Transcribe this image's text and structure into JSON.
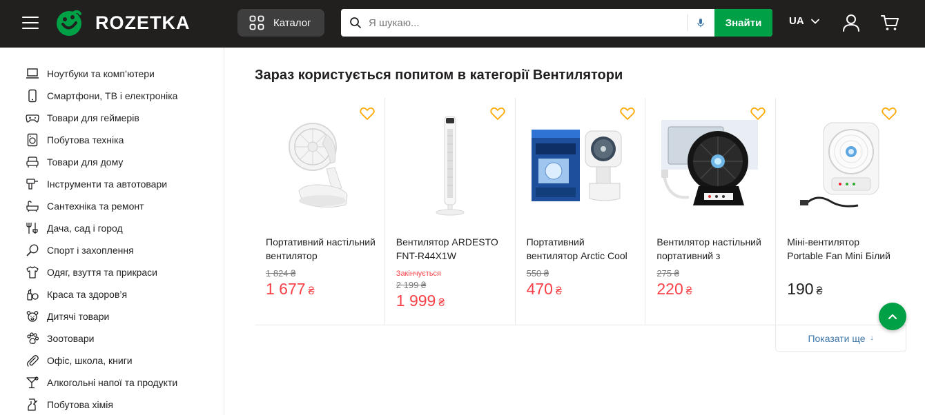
{
  "header": {
    "logo_text": "ROZETKA",
    "catalog_label": "Каталог",
    "search_placeholder": "Я шукаю...",
    "search_button": "Знайти",
    "language": "UA"
  },
  "sidebar": {
    "items": [
      {
        "label": "Ноутбуки та комп’ютери",
        "icon": "laptop-icon"
      },
      {
        "label": "Смартфони, ТВ і електроніка",
        "icon": "smartphone-icon"
      },
      {
        "label": "Товари для геймерів",
        "icon": "gamepad-icon"
      },
      {
        "label": "Побутова техніка",
        "icon": "washing-machine-icon"
      },
      {
        "label": "Товари для дому",
        "icon": "armchair-icon"
      },
      {
        "label": "Інструменти та автотовари",
        "icon": "drill-icon"
      },
      {
        "label": "Сантехніка та ремонт",
        "icon": "bathtub-icon"
      },
      {
        "label": "Дача, сад і город",
        "icon": "garden-tools-icon"
      },
      {
        "label": "Спорт і захоплення",
        "icon": "tennis-racket-icon"
      },
      {
        "label": "Одяг, взуття та прикраси",
        "icon": "tshirt-icon"
      },
      {
        "label": "Краса та здоров’я",
        "icon": "beauty-icon"
      },
      {
        "label": "Дитячі товари",
        "icon": "teddy-bear-icon"
      },
      {
        "label": "Зоотовари",
        "icon": "paw-icon"
      },
      {
        "label": "Офіс, школа, книги",
        "icon": "paperclip-icon"
      },
      {
        "label": "Алкогольні напої та продукти",
        "icon": "cocktail-icon"
      },
      {
        "label": "Побутова хімія",
        "icon": "spray-bottle-icon"
      }
    ]
  },
  "main": {
    "section_title": "Зараз користується попитом в категорії Вентилятори",
    "show_more": "Показати ще",
    "products": [
      {
        "name": "Портативний настільний вентилятор",
        "old_price": "1 824 ₴",
        "price": "1 677",
        "currency": "₴",
        "status": ""
      },
      {
        "name": "Вентилятор ARDESTO FNT-R44X1W",
        "old_price": "2 199 ₴",
        "price": "1 999",
        "currency": "₴",
        "status": "Закінчується"
      },
      {
        "name": "Портативний вентилятор Arctic Cool",
        "old_price": "550 ₴",
        "price": "470",
        "currency": "₴",
        "status": ""
      },
      {
        "name": "Вентилятор настільний портативний з",
        "old_price": "275 ₴",
        "price": "220",
        "currency": "₴",
        "status": ""
      },
      {
        "name": "Міні-вентилятор Portable Fan Mini Білий",
        "old_price": "",
        "price": "190",
        "currency": "₴",
        "status": ""
      }
    ]
  },
  "colors": {
    "header_bg": "#221f1f",
    "accent_green": "#00a046",
    "price_red": "#f84147",
    "link_blue": "#3e77aa",
    "heart_yellow": "#ffa900"
  }
}
